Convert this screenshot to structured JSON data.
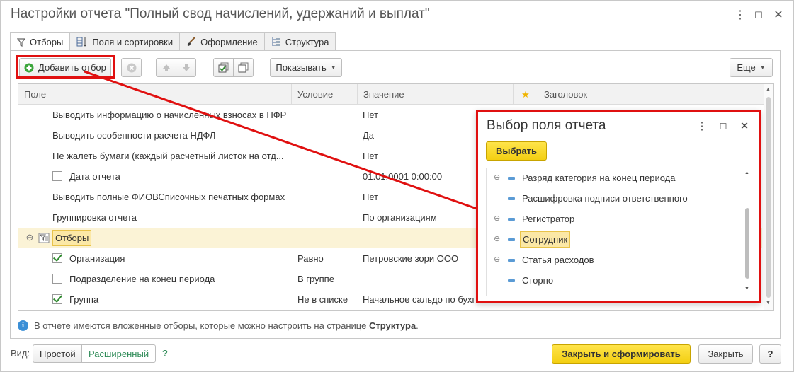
{
  "window": {
    "title": "Настройки отчета \"Полный свод начислений, удержаний и выплат\"",
    "controls": {
      "menu": "⋮",
      "maximize": "☐",
      "close": "✕"
    }
  },
  "tabs": [
    {
      "label": "Отборы",
      "icon": "funnel-icon",
      "active": true
    },
    {
      "label": "Поля и сортировки",
      "icon": "fields-sort-icon",
      "active": false
    },
    {
      "label": "Оформление",
      "icon": "brush-icon",
      "active": false
    },
    {
      "label": "Структура",
      "icon": "structure-icon",
      "active": false
    }
  ],
  "toolbar": {
    "add_filter_label": "Добавить отбор",
    "show_label": "Показывать",
    "more_label": "Еще"
  },
  "grid": {
    "columns": {
      "field": "Поле",
      "condition": "Условие",
      "value": "Значение",
      "star": "★",
      "header": "Заголовок"
    },
    "rows": [
      {
        "field": "Выводить информацию о начисленных взносах в ПФР",
        "condition": "",
        "value": "Нет",
        "checkbox": "none"
      },
      {
        "field": "Выводить особенности расчета НДФЛ",
        "condition": "",
        "value": "Да",
        "checkbox": "none"
      },
      {
        "field": "Не жалеть бумаги (каждый расчетный листок на отд...",
        "condition": "",
        "value": "Нет",
        "checkbox": "none"
      },
      {
        "field": "Дата отчета",
        "condition": "",
        "value": "01.01.0001 0:00:00",
        "checkbox": "off"
      },
      {
        "field": "Выводить полные ФИОВСписочных печатных формах",
        "condition": "",
        "value": "Нет",
        "checkbox": "none"
      },
      {
        "field": "Группировка отчета",
        "condition": "",
        "value": "По организациям",
        "checkbox": "none"
      },
      {
        "field": "Отборы",
        "condition": "",
        "value": "",
        "checkbox": "group"
      },
      {
        "field": "Организация",
        "condition": "Равно",
        "value": "Петровские зори ООО",
        "checkbox": "on"
      },
      {
        "field": "Подразделение на конец периода",
        "condition": "В группе",
        "value": "",
        "checkbox": "off"
      },
      {
        "field": "Группа",
        "condition": "Не в списке",
        "value": "Начальное сальдо по бухг",
        "checkbox": "on"
      }
    ]
  },
  "info": {
    "text": "В отчете имеются вложенные отборы, которые можно настроить на странице",
    "link": "Структура",
    "suffix": "."
  },
  "footer": {
    "view_label": "Вид:",
    "simple": "Простой",
    "extended": "Расширенный",
    "help_q": "?",
    "close_and_generate": "Закрыть и сформировать",
    "close": "Закрыть",
    "help_button": "?"
  },
  "dialog": {
    "title": "Выбор поля отчета",
    "select_label": "Выбрать",
    "items": [
      {
        "label": "Разряд категория на конец периода",
        "expandable": true,
        "selected": false
      },
      {
        "label": "Расшифровка подписи ответственного",
        "expandable": false,
        "selected": false
      },
      {
        "label": "Регистратор",
        "expandable": true,
        "selected": false
      },
      {
        "label": "Сотрудник",
        "expandable": true,
        "selected": true
      },
      {
        "label": "Статья расходов",
        "expandable": true,
        "selected": false
      },
      {
        "label": "Сторно",
        "expandable": false,
        "selected": false
      }
    ]
  },
  "colors": {
    "highlight_red": "#e01010",
    "primary_yellow": "#f5d320",
    "selection_yellow": "#fbe8a6",
    "group_row_bg": "#fbf3d6",
    "check_green": "#2f8a2f",
    "link_green": "#2e8b57",
    "info_blue": "#3b8fd6"
  }
}
